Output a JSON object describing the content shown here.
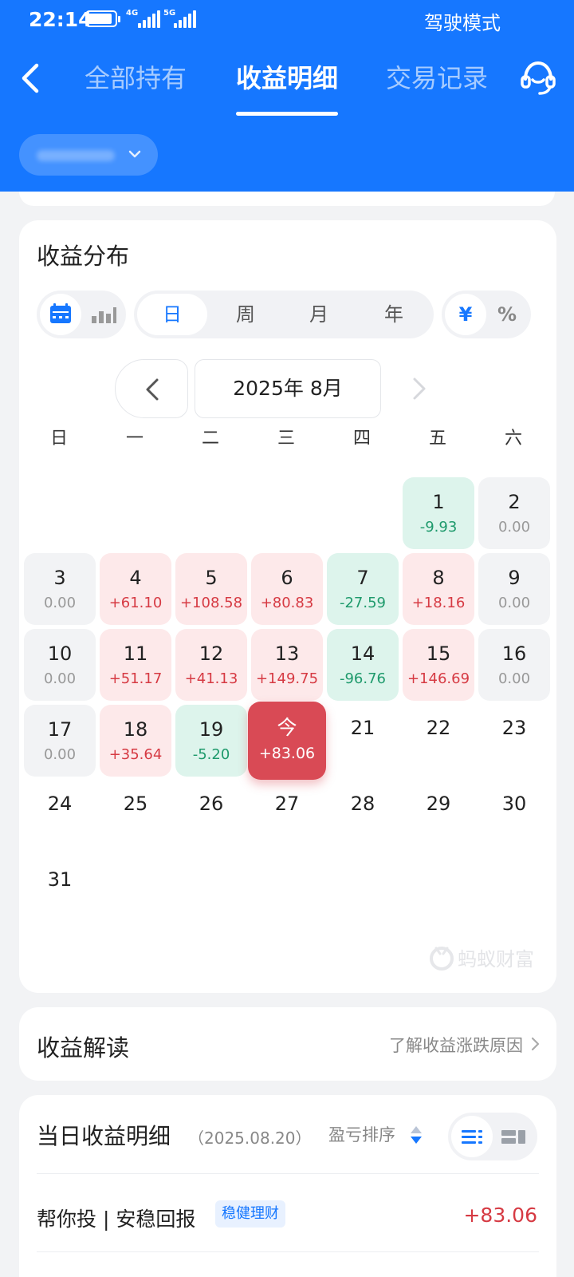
{
  "status_bar": {
    "time": "22:14",
    "net1": "4G",
    "net2": "5G",
    "drive_mode": "驾驶模式"
  },
  "nav": {
    "tabs": [
      {
        "label": "全部持有",
        "active": false
      },
      {
        "label": "收益明细",
        "active": true
      },
      {
        "label": "交易记录",
        "active": false
      }
    ]
  },
  "calendar_card": {
    "title": "收益分布",
    "view_icons": [
      "calendar-icon",
      "bar-chart-icon"
    ],
    "period_options": [
      "日",
      "周",
      "月",
      "年"
    ],
    "period_selected": "日",
    "unit_options": [
      "¥",
      "%"
    ],
    "unit_selected": "¥",
    "month_label": "2025年 8月",
    "weekdays": [
      "日",
      "一",
      "二",
      "三",
      "四",
      "五",
      "六"
    ],
    "days": [
      {
        "day": "1",
        "value": "-9.93",
        "state": "loss"
      },
      {
        "day": "2",
        "value": "0.00",
        "state": "flat"
      },
      {
        "day": "3",
        "value": "0.00",
        "state": "flat"
      },
      {
        "day": "4",
        "value": "+61.10",
        "state": "gain"
      },
      {
        "day": "5",
        "value": "+108.58",
        "state": "gain"
      },
      {
        "day": "6",
        "value": "+80.83",
        "state": "gain"
      },
      {
        "day": "7",
        "value": "-27.59",
        "state": "loss"
      },
      {
        "day": "8",
        "value": "+18.16",
        "state": "gain"
      },
      {
        "day": "9",
        "value": "0.00",
        "state": "flat"
      },
      {
        "day": "10",
        "value": "0.00",
        "state": "flat"
      },
      {
        "day": "11",
        "value": "+51.17",
        "state": "gain"
      },
      {
        "day": "12",
        "value": "+41.13",
        "state": "gain"
      },
      {
        "day": "13",
        "value": "+149.75",
        "state": "gain"
      },
      {
        "day": "14",
        "value": "-96.76",
        "state": "loss"
      },
      {
        "day": "15",
        "value": "+146.69",
        "state": "gain"
      },
      {
        "day": "16",
        "value": "0.00",
        "state": "flat"
      },
      {
        "day": "17",
        "value": "0.00",
        "state": "flat"
      },
      {
        "day": "18",
        "value": "+35.64",
        "state": "gain"
      },
      {
        "day": "19",
        "value": "-5.20",
        "state": "loss"
      },
      {
        "day": "今",
        "value": "+83.06",
        "state": "today"
      },
      {
        "day": "21",
        "value": "",
        "state": "plain"
      },
      {
        "day": "22",
        "value": "",
        "state": "plain"
      },
      {
        "day": "23",
        "value": "",
        "state": "plain"
      },
      {
        "day": "24",
        "value": "",
        "state": "plain"
      },
      {
        "day": "25",
        "value": "",
        "state": "plain"
      },
      {
        "day": "26",
        "value": "",
        "state": "plain"
      },
      {
        "day": "27",
        "value": "",
        "state": "plain"
      },
      {
        "day": "28",
        "value": "",
        "state": "plain"
      },
      {
        "day": "29",
        "value": "",
        "state": "plain"
      },
      {
        "day": "30",
        "value": "",
        "state": "plain"
      },
      {
        "day": "31",
        "value": "",
        "state": "plain"
      }
    ],
    "first_weekday_index": 5,
    "watermark": "蚂蚁财富"
  },
  "interpretation": {
    "title": "收益解读",
    "link": "了解收益涨跌原因"
  },
  "daily_detail": {
    "title": "当日收益明细",
    "date": "（2025.08.20）",
    "sort_label": "盈亏排序",
    "rows": [
      {
        "name": "帮你投 | 安稳回报",
        "tag": "稳健理财",
        "amount": "+83.06"
      }
    ]
  },
  "colors": {
    "primary": "#1677ff",
    "gain": "#d63a43",
    "loss": "#1e9a6c",
    "today_bg": "#d94a55"
  }
}
